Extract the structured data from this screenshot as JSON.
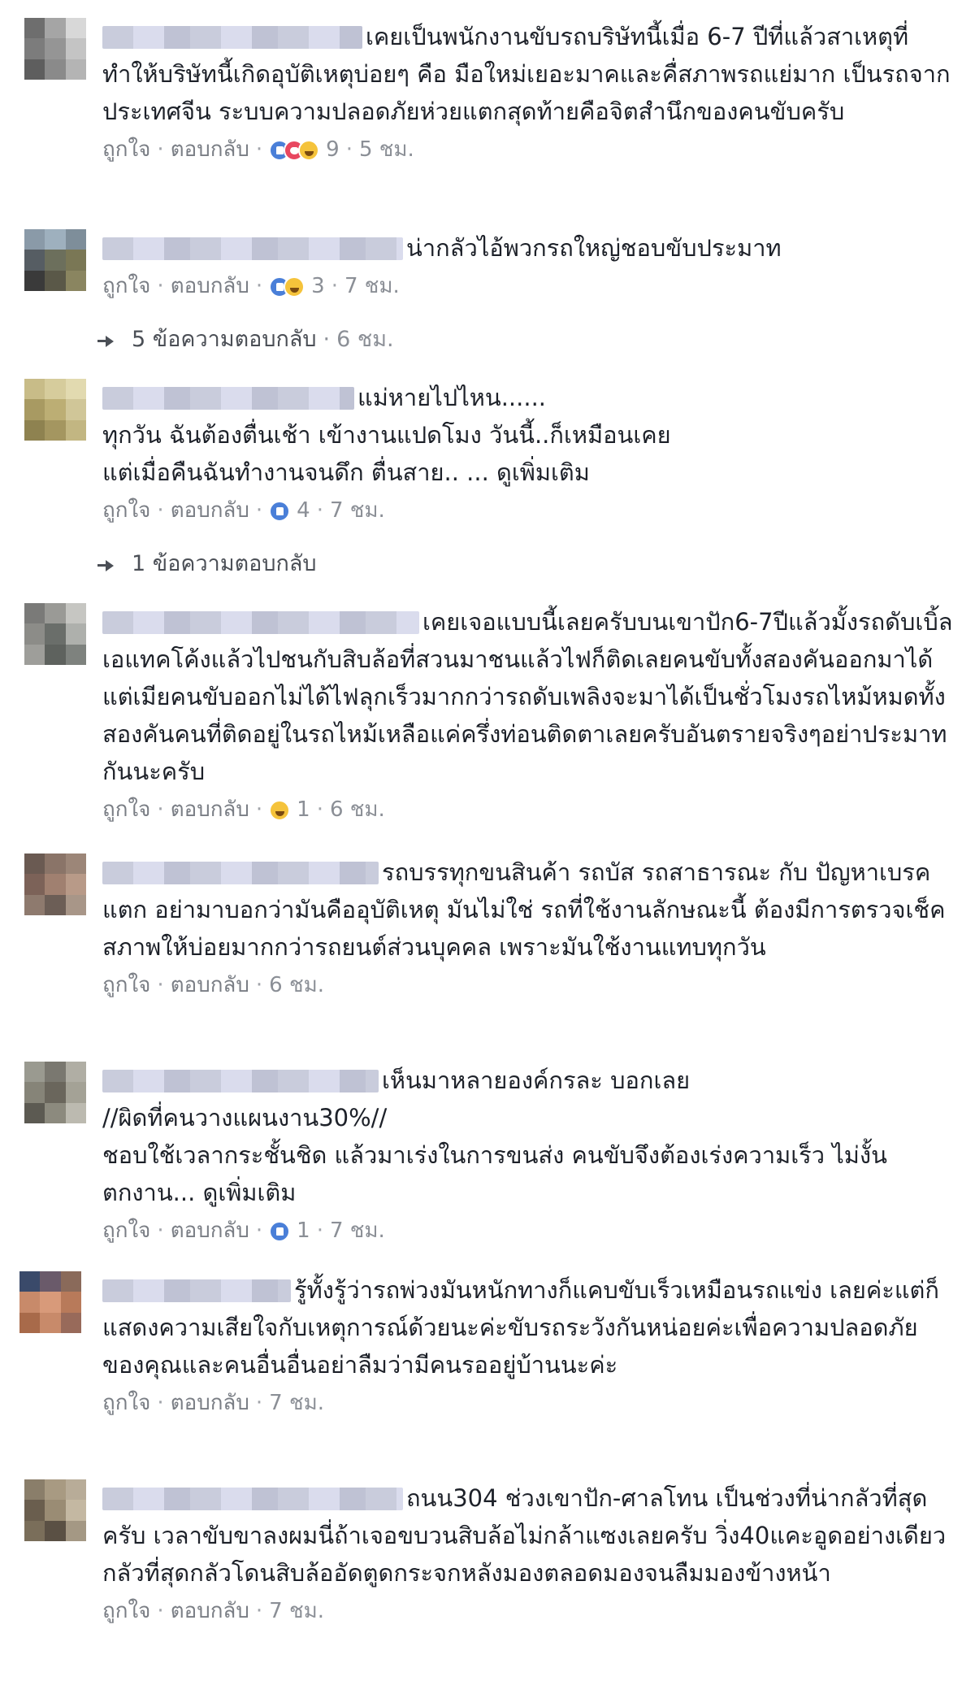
{
  "labels": {
    "like": "ถูกใจ",
    "reply": "ตอบกลับ",
    "separator": "·"
  },
  "comments": [
    {
      "text": "เคยเป็นพนักงานขับรถบริษัทนี้เมื่อ 6-7 ปีที่แล้วสาเหตุที่ทำให้บริษัทนี้เกิดอุบัติเหตุบ่อยๆ คือ มือใหม่เยอะมาคและคื่สภาพรถแย่มาก เป็นรถจากประเทศจีน ระบบความปลอดภัยห่วยแตกสุดท้ายคือจิตสำนึกของคนขับครับ",
      "see_more": "",
      "reactions": [
        "like",
        "love",
        "haha"
      ],
      "reaction_count": "9",
      "time": "5 ชม."
    },
    {
      "text": "น่ากลัวไอ้พวกรถใหญ่ชอบขับประมาท",
      "see_more": "",
      "reactions": [
        "like",
        "haha"
      ],
      "reaction_count": "3",
      "time": "7 ชม."
    },
    {
      "text": "แม่หายไปไหน......\nทุกวัน ฉันต้องตื่นเช้า เข้างานแปดโมง วันนี้..ก็เหมือนเคย\nแต่เมื่อคืนฉันทำงานจนดึก ตื่นสาย.. ...",
      "see_more": "ดูเพิ่มเติม",
      "reactions": [
        "like"
      ],
      "reaction_count": "4",
      "time": "7 ชม."
    },
    {
      "text": "เคยเจอแบบนี้เลยครับบนเขาปัก6-7ปีแล้วมั้งรถดับเบิ้ลเอแทคโค้งแล้วไปชนกับสิบล้อที่สวนมาชนแล้วไฟก็ติดเลยคนขับทั้งสองคันออกมาได้แต่เมียคนขับออกไม่ได้ไฟลุกเร็วมากกว่ารถดับเพลิงจะมาได้เป็นชั่วโมงรถไหม้หมดทั้งสองคันคนที่ติดอยู่ในรถไหม้เหลือแค่ครึ่งท่อนติดตาเลยครับอันตรายจริงๆอย่าประมาทกันนะครับ",
      "see_more": "",
      "reactions": [
        "haha"
      ],
      "reaction_count": "1",
      "time": "6 ชม."
    },
    {
      "text": "รถบรรทุกขนสินค้า รถบัส รถสาธารณะ กับ ปัญหาเบรคแตก อย่ามาบอกว่ามันคืออุบัติเหตุ มันไม่ใช่ รถที่ใช้งานลักษณะนี้ ต้องมีการตรวจเช็คสภาพให้บ่อยมากกว่ารถยนต์ส่วนบุคคล เพราะมันใช้งานแทบทุกวัน",
      "see_more": "",
      "reactions": [],
      "reaction_count": "",
      "time": "6 ชม."
    },
    {
      "text": "เห็นมาหลายองค์กรละ บอกเลย\n//ผิดที่คนวางแผนงาน30%//\nชอบใช้เวลากระชั้นชิด แล้วมาเร่งในการขนส่ง คนขับจึงต้องเร่งความเร็ว ไม่งั้นตกงาน...",
      "see_more": "ดูเพิ่มเติม",
      "reactions": [
        "like"
      ],
      "reaction_count": "1",
      "time": "7 ชม."
    },
    {
      "text": "รู้ทั้งรู้ว่ารถพ่วงมันหนักทางก็แคบขับเร็วเหมือนรถแข่ง เลยค่ะแต่ก็แสดงความเสียใจกับเหตุการณ์ด้วยนะค่ะขับรถระวังกันหน่อยค่ะเพื่อความปลอดภัยของคุณและคนอื่นอื่นอย่าลืมว่ามีคนรออยู่บ้านนะค่ะ",
      "see_more": "",
      "reactions": [],
      "reaction_count": "",
      "time": "7 ชม."
    },
    {
      "text": "ถนน304 ช่วงเขาปัก-ศาลโทน เป็นช่วงที่น่ากลัวที่สุดครับ เวลาขับขาลงผมนี่ถ้าเจอขบวนสิบล้อไม่กล้าแซงเลยครับ วิ่ง40แคะอูดอย่างเดียว กลัวที่สุดกลัวโดนสิบล้ออัดตูดกระจกหลังมองตลอดมองจนลืมมองข้างหน้า",
      "see_more": "",
      "reactions": [],
      "reaction_count": "",
      "time": "7 ชม."
    }
  ],
  "reply_summaries": [
    {
      "text": "5 ข้อความตอบกลับ",
      "time": "6 ชม."
    },
    {
      "text": "1 ข้อความตอบกลับ",
      "time": ""
    }
  ]
}
